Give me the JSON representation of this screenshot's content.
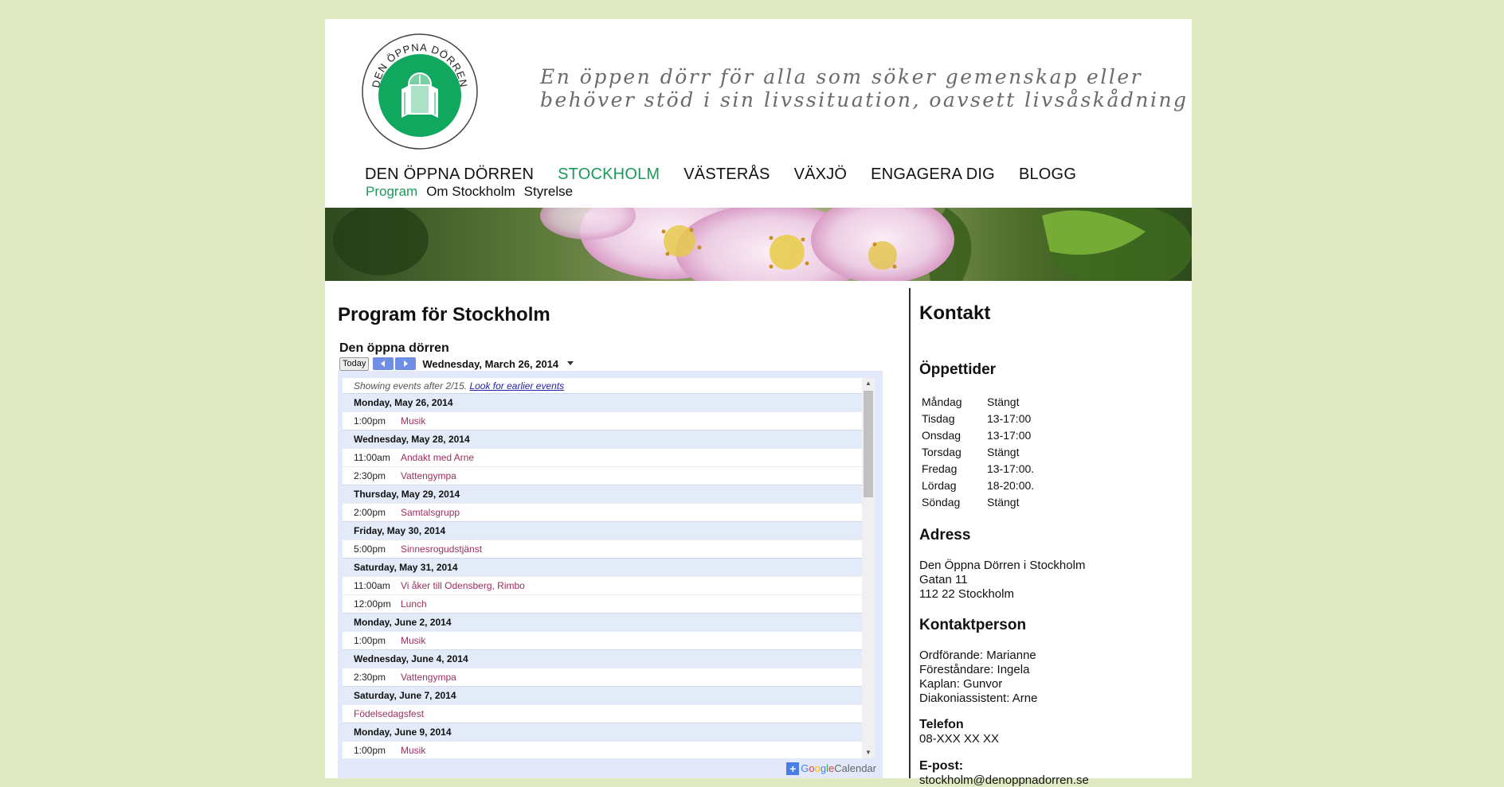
{
  "header": {
    "logo_text": "DEN ÖPPNA DÖRREN",
    "tagline_line1": "En öppen dörr för alla som söker gemenskap eller",
    "tagline_line2": "behöver stöd i sin livssituation, oavsett livsåskådning"
  },
  "nav": {
    "items": [
      {
        "label": "DEN ÖPPNA DÖRREN",
        "active": false
      },
      {
        "label": "STOCKHOLM",
        "active": true
      },
      {
        "label": "VÄSTERÅS",
        "active": false
      },
      {
        "label": "VÄXJÖ",
        "active": false
      },
      {
        "label": "ENGAGERA DIG",
        "active": false
      },
      {
        "label": "BLOGG",
        "active": false
      }
    ],
    "sub": [
      {
        "label": "Program",
        "active": true
      },
      {
        "label": "Om Stockholm",
        "active": false
      },
      {
        "label": "Styrelse",
        "active": false
      }
    ]
  },
  "content": {
    "title": "Program för Stockholm"
  },
  "calendar": {
    "name": "Den öppna dörren",
    "today_label": "Today",
    "current_date": "Wednesday, March 26, 2014",
    "info_text": "Showing events after 2/15.",
    "earlier_link": "Look for earlier events",
    "google_label": "Google",
    "calendar_label": "Calendar",
    "days": [
      {
        "date": "Monday, May 26, 2014",
        "events": [
          {
            "time": "1:00pm",
            "title": "Musik"
          }
        ]
      },
      {
        "date": "Wednesday, May 28, 2014",
        "events": [
          {
            "time": "11:00am",
            "title": "Andakt med Arne"
          },
          {
            "time": "2:30pm",
            "title": "Vattengympa"
          }
        ]
      },
      {
        "date": "Thursday, May 29, 2014",
        "events": [
          {
            "time": "2:00pm",
            "title": "Samtalsgrupp"
          }
        ]
      },
      {
        "date": "Friday, May 30, 2014",
        "events": [
          {
            "time": "5:00pm",
            "title": "Sinnesrogudstjänst"
          }
        ]
      },
      {
        "date": "Saturday, May 31, 2014",
        "events": [
          {
            "time": "11:00am",
            "title": "Vi åker till Odensberg, Rimbo"
          },
          {
            "time": "12:00pm",
            "title": "Lunch"
          }
        ]
      },
      {
        "date": "Monday, June 2, 2014",
        "events": [
          {
            "time": "1:00pm",
            "title": "Musik"
          }
        ]
      },
      {
        "date": "Wednesday, June 4, 2014",
        "events": [
          {
            "time": "2:30pm",
            "title": "Vattengympa"
          }
        ]
      },
      {
        "date": "Saturday, June 7, 2014",
        "events": [
          {
            "time": "",
            "title": "Födelsedagsfest"
          }
        ]
      },
      {
        "date": "Monday, June 9, 2014",
        "events": [
          {
            "time": "1:00pm",
            "title": "Musik"
          }
        ]
      }
    ],
    "colors": {
      "event_title": "#9c3060",
      "day_bg": "#e4ebf8",
      "frame": "#e3e9fb"
    }
  },
  "sidebar": {
    "title": "Kontakt",
    "hours_title": "Öppettider",
    "hours": [
      {
        "day": "Måndag",
        "time": "Stängt"
      },
      {
        "day": "Tisdag",
        "time": "13-17:00"
      },
      {
        "day": "Onsdag",
        "time": "13-17:00"
      },
      {
        "day": "Torsdag",
        "time": "Stängt"
      },
      {
        "day": "Fredag",
        "time": "13-17:00."
      },
      {
        "day": "Lördag",
        "time": "18-20:00."
      },
      {
        "day": "Söndag",
        "time": "Stängt"
      }
    ],
    "address_title": "Adress",
    "address_lines": [
      "Den Öppna Dörren i Stockholm",
      "Gatan 11",
      "112 22 Stockholm"
    ],
    "contact_title": "Kontaktperson",
    "contact_lines": [
      "Ordförande: Marianne",
      "Föreståndare: Ingela",
      "Kaplan: Gunvor",
      "Diakoniassistent: Arne"
    ],
    "phone_label": "Telefon",
    "phone": "08-XXX XX XX",
    "email_label": "E-post:",
    "email": "stockholm@denoppnadorren.se"
  },
  "theme": {
    "page_bg": "#dfeac3",
    "accent": "#1a9a5a",
    "logo_green": "#0fa85e"
  }
}
